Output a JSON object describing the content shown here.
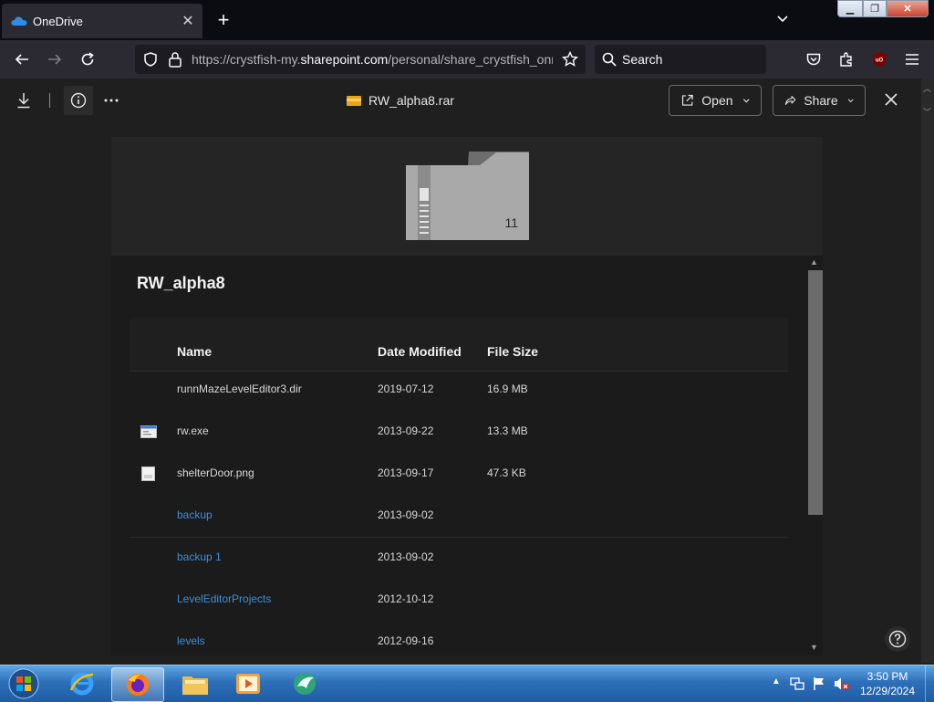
{
  "browser": {
    "tab_title": "OneDrive",
    "new_tab_label": "+",
    "url_prefix": "https://crystfish-my.",
    "url_domain": "sharepoint.com",
    "url_rest": "/personal/share_crystfish_onmicrosoft_com",
    "search_placeholder": "Search"
  },
  "viewer": {
    "file_name": "RW_alpha8.rar",
    "open_label": "Open",
    "share_label": "Share"
  },
  "archive": {
    "item_count": "11",
    "title": "RW_alpha8",
    "columns": {
      "name": "Name",
      "date": "Date Modified",
      "size": "File Size"
    },
    "rows": [
      {
        "name": "runnMazeLevelEditor3.dir",
        "date": "2019-07-12",
        "size": "16.9 MB",
        "icon": "none",
        "link": false
      },
      {
        "name": "rw.exe",
        "date": "2013-09-22",
        "size": "13.3 MB",
        "icon": "exe-icon",
        "link": false
      },
      {
        "name": "shelterDoor.png",
        "date": "2013-09-17",
        "size": "47.3 KB",
        "icon": "image-icon",
        "link": false
      },
      {
        "name": "backup",
        "date": "2013-09-02",
        "size": "",
        "icon": "none",
        "link": true
      },
      {
        "name": "backup 1",
        "date": "2013-09-02",
        "size": "",
        "icon": "none",
        "link": true
      },
      {
        "name": "LevelEditorProjects",
        "date": "2012-10-12",
        "size": "",
        "icon": "none",
        "link": true
      },
      {
        "name": "levels",
        "date": "2012-09-16",
        "size": "",
        "icon": "none",
        "link": true
      }
    ]
  },
  "taskbar": {
    "time": "3:50 PM",
    "date": "12/29/2024"
  },
  "colors": {
    "link": "#3a8fdb",
    "background": "#1f1f1f",
    "panel": "#1b1b1b"
  }
}
